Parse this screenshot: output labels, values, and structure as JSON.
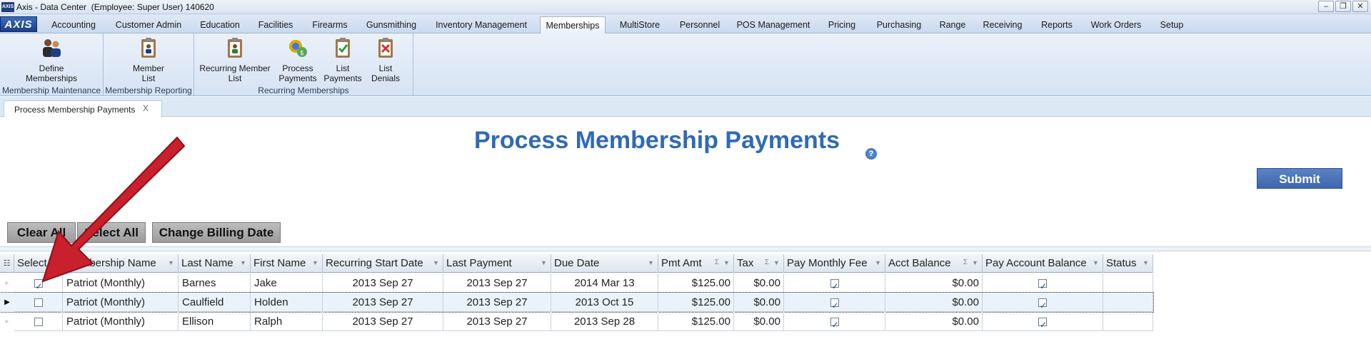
{
  "window": {
    "app_icon": "AXIS",
    "title": "Axis - Data Center  (Employee: Super User) 140620",
    "controls": [
      "minimize",
      "restore",
      "close"
    ]
  },
  "menu": {
    "logo": "AXIS",
    "tabs": [
      "Accounting",
      "Customer Admin",
      "Education",
      "Facilities",
      "Firearms",
      "Gunsmithing",
      "Inventory Management",
      "Memberships",
      "MultiStore",
      "Personnel",
      "POS Management",
      "Pricing",
      "Purchasing",
      "Range",
      "Receiving",
      "Reports",
      "Work Orders",
      "Setup"
    ],
    "active_tab": "Memberships"
  },
  "ribbon": {
    "groups": [
      {
        "label": "Membership Maintenance",
        "buttons": [
          {
            "line1": "Define",
            "line2": "Memberships",
            "icon": "people-icon"
          }
        ]
      },
      {
        "label": "Membership Reporting",
        "buttons": [
          {
            "line1": "Member",
            "line2": "List",
            "icon": "clipboard-member-icon"
          }
        ]
      },
      {
        "label": "Recurring Memberships",
        "buttons": [
          {
            "line1": "Recurring Member",
            "line2": "List",
            "icon": "clipboard-recurring-icon"
          },
          {
            "line1": "Process",
            "line2": "Payments",
            "icon": "process-payments-icon"
          },
          {
            "line1": "List",
            "line2": "Payments",
            "icon": "clipboard-check-icon"
          },
          {
            "line1": "List",
            "line2": "Denials",
            "icon": "clipboard-denial-icon"
          }
        ]
      }
    ]
  },
  "document_tab": {
    "label": "Process Membership Payments",
    "close": "X"
  },
  "page": {
    "title": "Process Membership Payments",
    "help": "?",
    "submit_label": "Submit",
    "clear_all_label": "Clear All",
    "select_all_label": "Select All",
    "change_billing_label": "Change Billing Date"
  },
  "grid": {
    "columns": [
      "Select",
      "Membership Name",
      "Last Name",
      "First Name",
      "Recurring Start Date",
      "Last Payment",
      "Due Date",
      "Pmt Amt",
      "Tax",
      "Pay Monthly Fee",
      "Acct Balance",
      "Pay Account Balance",
      "Status"
    ],
    "rows": [
      {
        "select": true,
        "membership": "Patriot (Monthly)",
        "last": "Barnes",
        "first": "Jake",
        "start": "2013 Sep 27",
        "last_payment": "2013 Sep 27",
        "due": "2014 Mar 13",
        "pmt": "$125.00",
        "tax": "$0.00",
        "pay_monthly": true,
        "acct_balance": "$0.00",
        "pay_balance": true,
        "status": ""
      },
      {
        "select": false,
        "membership": "Patriot (Monthly)",
        "last": "Caulfield",
        "first": "Holden",
        "start": "2013 Sep 27",
        "last_payment": "2013 Sep 27",
        "due": "2013 Oct 15",
        "pmt": "$125.00",
        "tax": "$0.00",
        "pay_monthly": true,
        "acct_balance": "$0.00",
        "pay_balance": true,
        "status": ""
      },
      {
        "select": false,
        "membership": "Patriot (Monthly)",
        "last": "Ellison",
        "first": "Ralph",
        "start": "2013 Sep 27",
        "last_payment": "2013 Sep 27",
        "due": "2013 Sep 28",
        "pmt": "$125.00",
        "tax": "$0.00",
        "pay_monthly": true,
        "acct_balance": "$0.00",
        "pay_balance": true,
        "status": ""
      }
    ],
    "current_row": 1
  },
  "annotation": {
    "color": "#c8202c"
  }
}
